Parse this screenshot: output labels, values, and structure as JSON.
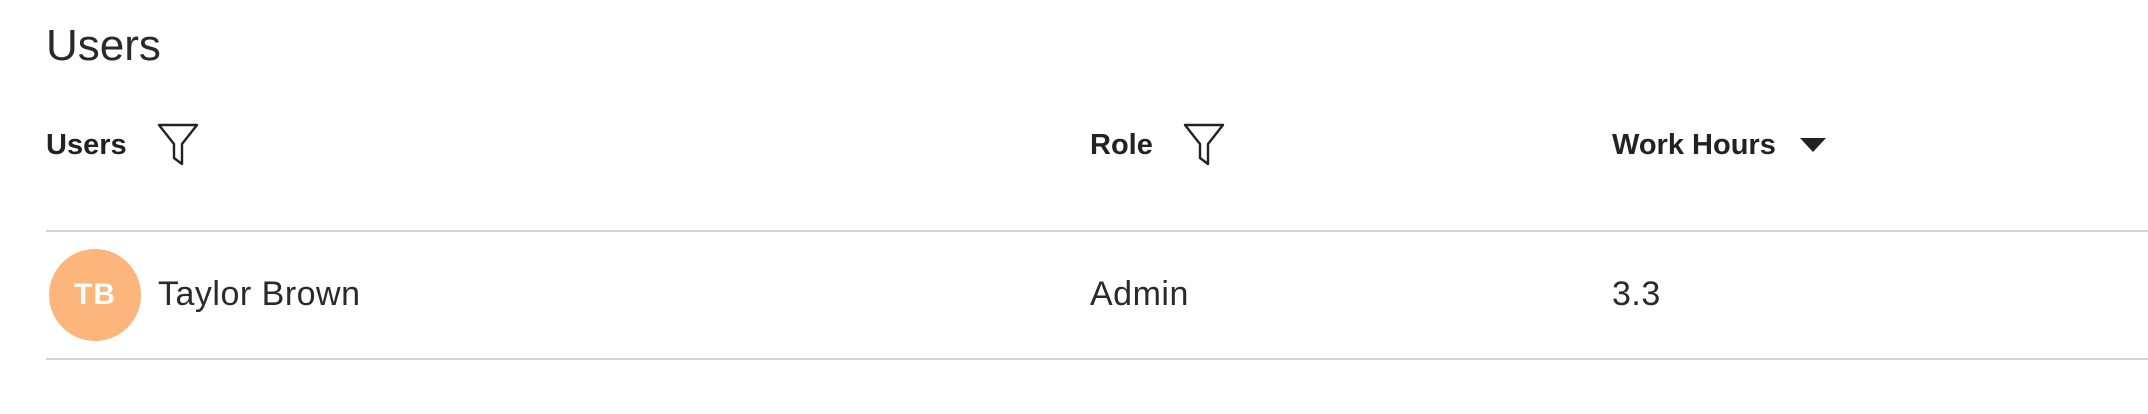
{
  "page": {
    "title": "Users"
  },
  "table": {
    "columns": [
      {
        "label": "Users",
        "control": "filter-icon"
      },
      {
        "label": "Role",
        "control": "filter-icon"
      },
      {
        "label": "Work Hours",
        "control": "sort-descending-icon"
      }
    ],
    "rows": [
      {
        "initials": "TB",
        "name": "Taylor Brown",
        "role": "Admin",
        "work_hours": "3.3"
      }
    ]
  },
  "colors": {
    "avatar_bg": "#fcb57a",
    "divider": "#d4d4d4",
    "text": "#222222"
  }
}
